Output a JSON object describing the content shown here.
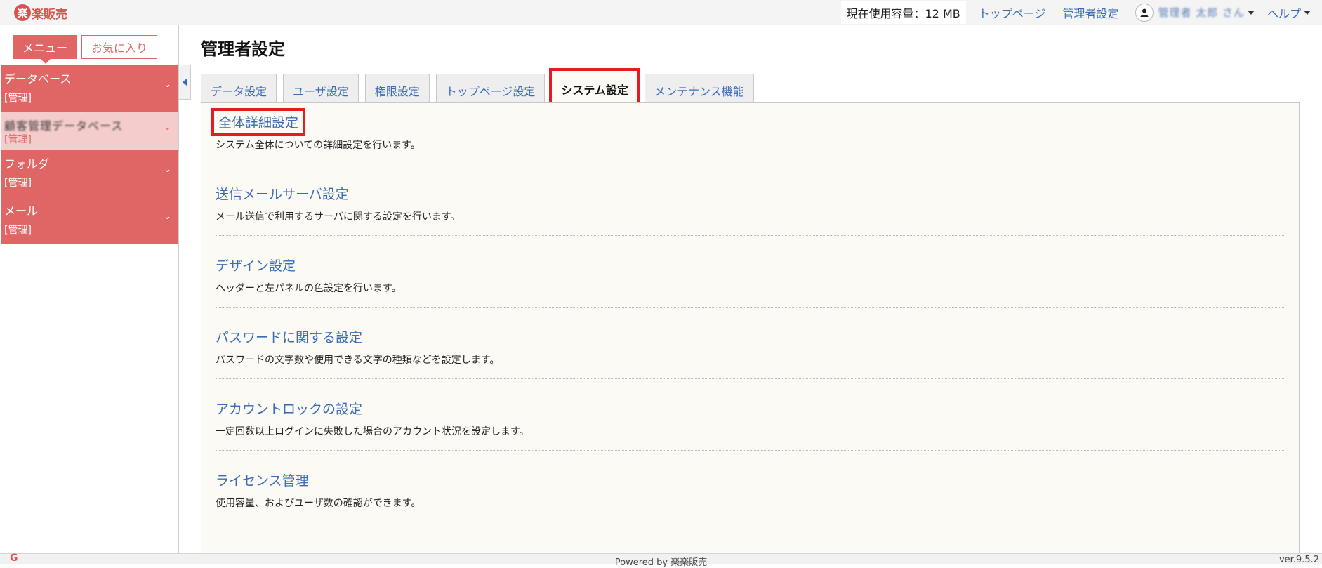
{
  "app": {
    "logo_mark": "楽",
    "logo_text": "楽販売"
  },
  "header": {
    "usage": "現在使用容量：12 MB",
    "links": [
      "トップページ",
      "管理者設定"
    ],
    "user_name": "管理者 太郎 さん",
    "help_label": "ヘルプ"
  },
  "sidebar": {
    "tab_menu": "メニュー",
    "tab_favorites": "お気に入り",
    "items": [
      {
        "label": "データベース",
        "sub": "[管理]",
        "chevron": "⌄"
      },
      {
        "label": "顧客管理データベース",
        "sub": "[管理]",
        "chevron": "⌄"
      },
      {
        "label": "フォルダ",
        "sub": "[管理]",
        "chevron": "⌄"
      },
      {
        "label": "メール",
        "sub": "[管理]",
        "chevron": "⌄"
      }
    ]
  },
  "main": {
    "title": "管理者設定",
    "tabs": [
      {
        "label": "データ設定"
      },
      {
        "label": "ユーザ設定"
      },
      {
        "label": "権限設定"
      },
      {
        "label": "トップページ設定"
      },
      {
        "label": "システム設定",
        "active": true
      },
      {
        "label": "メンテナンス機能"
      }
    ],
    "settings": [
      {
        "title": "全体詳細設定",
        "desc": "システム全体についての詳細設定を行います。",
        "highlighted": true
      },
      {
        "title": "送信メールサーバ設定",
        "desc": "メール送信で利用するサーバに関する設定を行います。"
      },
      {
        "title": "デザイン設定",
        "desc": "ヘッダーと左パネルの色設定を行います。"
      },
      {
        "title": "パスワードに関する設定",
        "desc": "パスワードの文字数や使用できる文字の種類などを設定します。"
      },
      {
        "title": "アカウントロックの設定",
        "desc": "一定回数以上ログインに失敗した場合のアカウント状況を設定します。"
      },
      {
        "title": "ライセンス管理",
        "desc": "使用容量、およびユーザ数の確認ができます。"
      }
    ]
  },
  "footer": {
    "icon": "G",
    "powered_by": "Powered by 楽楽販売",
    "version": "ver.9.5.2"
  },
  "colors": {
    "accent": "#e06666",
    "link": "#3a6cb5",
    "highlight_border": "#e21c23",
    "panel_bg": "#fbfaf5"
  }
}
